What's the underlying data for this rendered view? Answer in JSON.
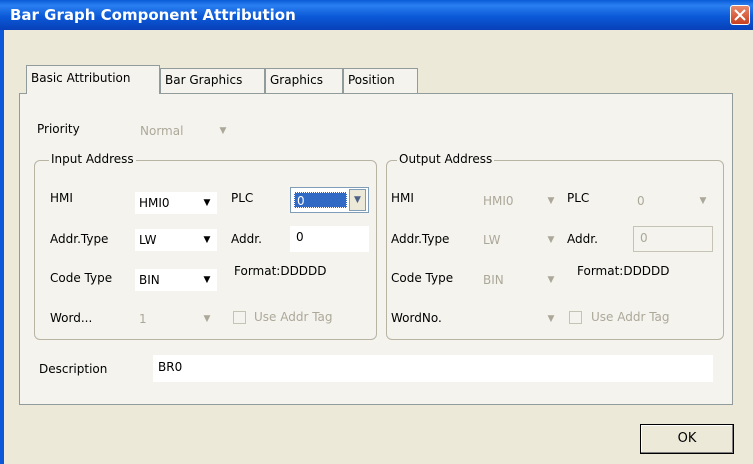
{
  "window": {
    "title": "Bar Graph Component Attribution"
  },
  "tabs": [
    {
      "label": "Basic Attribution"
    },
    {
      "label": "Bar Graphics"
    },
    {
      "label": "Graphics"
    },
    {
      "label": "Position"
    }
  ],
  "priority": {
    "label": "Priority",
    "value": "Normal"
  },
  "input": {
    "title": "Input Address",
    "hmi_label": "HMI",
    "hmi_value": "HMI0",
    "plc_label": "PLC",
    "plc_value": "0",
    "addr_type_label": "Addr.Type",
    "addr_type_value": "LW",
    "addr_label": "Addr.",
    "addr_value": "0",
    "code_type_label": "Code Type",
    "code_type_value": "BIN",
    "format": "Format:DDDDD",
    "word_label": "Word...",
    "word_value": "1",
    "use_addr_tag": "Use Addr Tag"
  },
  "output": {
    "title": "Output Address",
    "hmi_label": "HMI",
    "hmi_value": "HMI0",
    "plc_label": "PLC",
    "plc_value": "0",
    "addr_type_label": "Addr.Type",
    "addr_type_value": "LW",
    "addr_label": "Addr.",
    "addr_value": "0",
    "code_type_label": "Code Type",
    "code_type_value": "BIN",
    "format": "Format:DDDDD",
    "word_label": "WordNo.",
    "word_value": "",
    "use_addr_tag": "Use Addr Tag"
  },
  "description": {
    "label": "Description",
    "value": "BR0"
  },
  "ok_label": "OK"
}
